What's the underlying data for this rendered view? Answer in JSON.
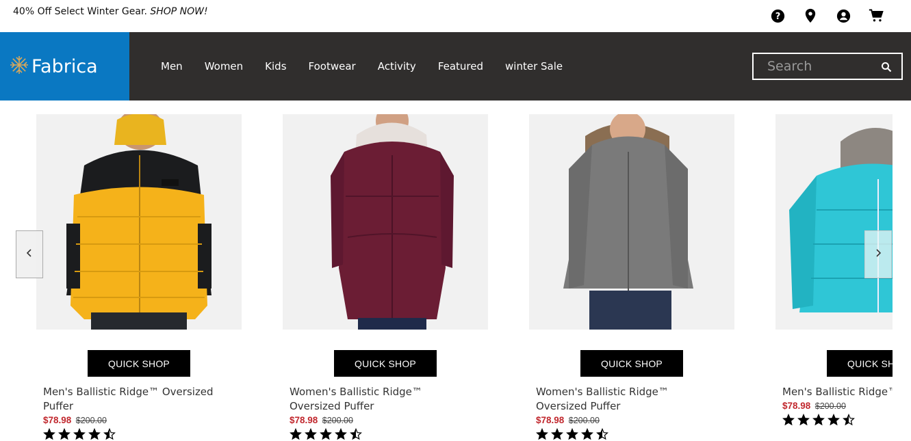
{
  "promo": {
    "text": "40% Off Select Winter Gear.",
    "cta": "SHOP NOW!"
  },
  "util_icons": [
    "help-icon",
    "location-pin-icon",
    "account-icon",
    "cart-icon"
  ],
  "brand": {
    "name": "Fabrica",
    "color": "#0a78c2"
  },
  "nav": {
    "items": [
      "Men",
      "Women",
      "Kids",
      "Footwear",
      "Activity",
      "Featured",
      "winter Sale"
    ],
    "background": "#302e2d"
  },
  "search": {
    "placeholder": "Search"
  },
  "products": [
    {
      "name": "Men's Ballistic Ridge™ Oversized Puffer",
      "sale_price": "$78.98",
      "orig_price": "$200.00",
      "rating": 4.5,
      "cta": "QUICK SHOP"
    },
    {
      "name": "Women's Ballistic Ridge™ Oversized Puffer",
      "sale_price": "$78.98",
      "orig_price": "$200.00",
      "rating": 4.5,
      "cta": "QUICK SHOP"
    },
    {
      "name": "Women's Ballistic Ridge™ Oversized Puffer",
      "sale_price": "$78.98",
      "orig_price": "$200.00",
      "rating": 4.5,
      "cta": "QUICK SHOP"
    },
    {
      "name": "Men's Ballistic Ridge™",
      "sale_price": "$78.98",
      "orig_price": "$200.00",
      "rating": 4.5,
      "cta": "QUICK SHOP"
    }
  ],
  "carousel": {
    "prev_icon": "chevron-left-icon",
    "next_icon": "chevron-right-icon"
  },
  "colors": {
    "sale": "#c1272d"
  }
}
